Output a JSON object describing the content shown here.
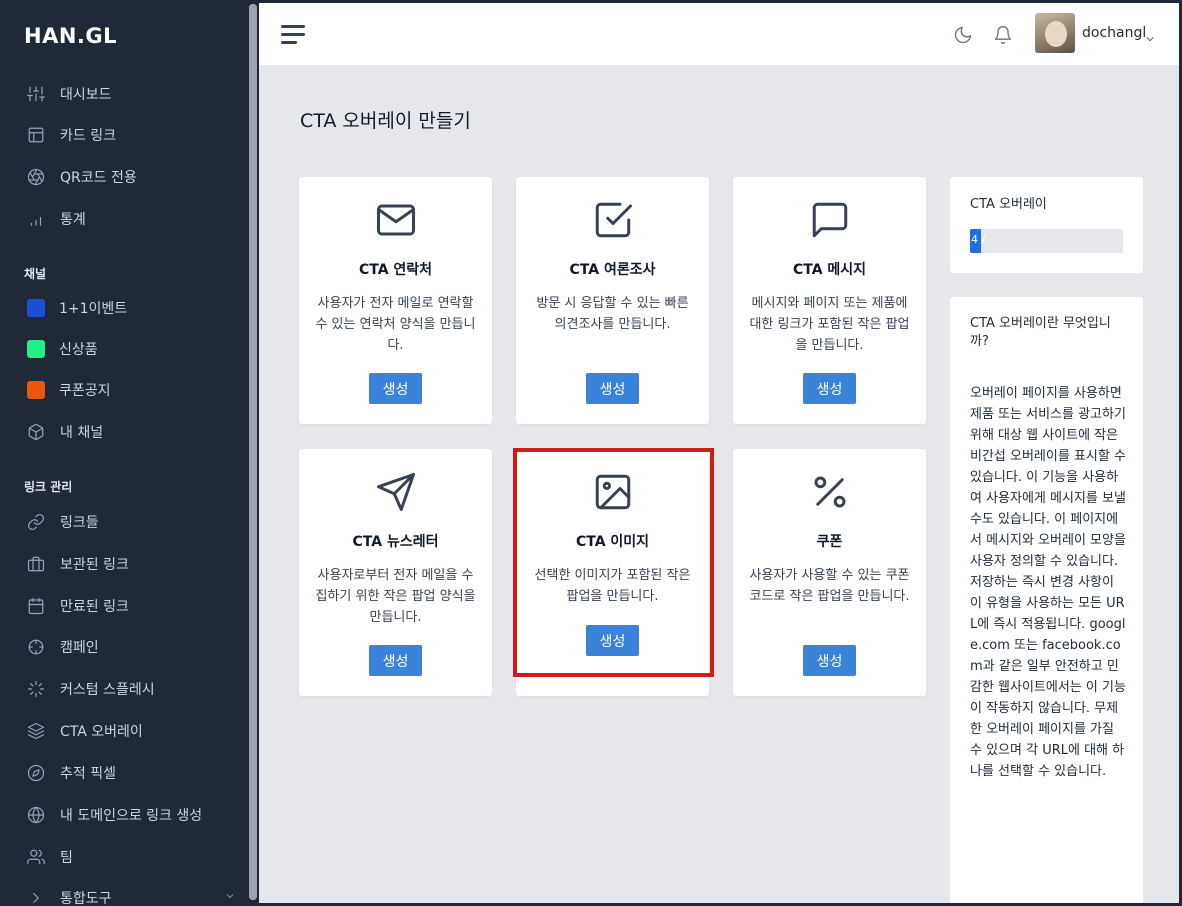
{
  "brand": {
    "logo": "HAN.GL"
  },
  "sidebar": {
    "items": [
      {
        "label": "대시보드",
        "icon": "sliders-icon"
      },
      {
        "label": "카드 링크",
        "icon": "layout-icon"
      },
      {
        "label": "QR코드 전용",
        "icon": "aperture-icon"
      },
      {
        "label": "통계",
        "icon": "bar-chart-icon"
      }
    ],
    "channels_title": "채널",
    "channels": [
      {
        "label": "1+1이벤트",
        "color": "#1d4ed8"
      },
      {
        "label": "신상품",
        "color": "#22ee88"
      },
      {
        "label": "쿠폰공지",
        "color": "#ea580c"
      },
      {
        "label": "내 채널",
        "icon": "box-icon"
      }
    ],
    "links_title": "링크 관리",
    "links": [
      {
        "label": "링크들",
        "icon": "link-icon"
      },
      {
        "label": "보관된 링크",
        "icon": "briefcase-icon"
      },
      {
        "label": "만료된 링크",
        "icon": "calendar-icon"
      },
      {
        "label": "캠페인",
        "icon": "crosshair-icon"
      },
      {
        "label": "커스텀 스플레시",
        "icon": "loader-icon"
      },
      {
        "label": "CTA 오버레이",
        "icon": "layers-icon"
      },
      {
        "label": "추적 픽셀",
        "icon": "compass-icon"
      },
      {
        "label": "내 도메인으로 링크 생성",
        "icon": "globe-icon"
      },
      {
        "label": "팀",
        "icon": "users-icon"
      },
      {
        "label": "통합도구",
        "icon": "chevron-right-icon"
      }
    ]
  },
  "topbar": {
    "username": "dochangl"
  },
  "page": {
    "title": "CTA 오버레이 만들기"
  },
  "cards": [
    {
      "title": "CTA 연락처",
      "desc": "사용자가 전자 메일로 연락할 수 있는 연락처 양식을 만듭니다.",
      "button": "생성",
      "icon": "mail-icon"
    },
    {
      "title": "CTA 여론조사",
      "desc": "방문 시 응답할 수 있는 빠른 의견조사를 만듭니다.",
      "button": "생성",
      "icon": "check-square-icon"
    },
    {
      "title": "CTA 메시지",
      "desc": "메시지와 페이지 또는 제품에 대한 링크가 포함된 작은 팝업을 만듭니다.",
      "button": "생성",
      "icon": "message-square-icon"
    },
    {
      "title": "CTA 뉴스레터",
      "desc": "사용자로부터 전자 메일을 수집하기 위한 작은 팝업 양식을 만듭니다.",
      "button": "생성",
      "icon": "send-icon"
    },
    {
      "title": "CTA 이미지",
      "desc": "선택한 이미지가 포함된 작은 팝업을 만듭니다.",
      "button": "생성",
      "icon": "image-icon"
    },
    {
      "title": "쿠폰",
      "desc": "사용자가 사용할 수 있는 쿠폰 코드로 작은 팝업을 만듭니다.",
      "button": "생성",
      "icon": "percent-icon"
    }
  ],
  "usage": {
    "title": "CTA 오버레이",
    "label": "4 /",
    "fraction": 0.07
  },
  "info": {
    "title": "CTA 오버레이란 무엇입니까?",
    "body": "오버레이 페이지를 사용하면 제품 또는 서비스를 광고하기 위해 대상 웹 사이트에 작은 비간섭 오버레이를 표시할 수 있습니다. 이 기능을 사용하여 사용자에게 메시지를 보낼 수도 있습니다. 이 페이지에서 메시지와 오버레이 모양을 사용자 정의할 수 있습니다. 저장하는 즉시 변경 사항이 이 유형을 사용하는 모든 URL에 즉시 적용됩니다. google.com 또는 facebook.com과 같은 일부 안전하고 민감한 웹사이트에서는 이 기능이 작동하지 않습니다. 무제한 오버레이 페이지를 가질 수 있으며 각 URL에 대해 하나를 선택할 수 있습니다."
  }
}
